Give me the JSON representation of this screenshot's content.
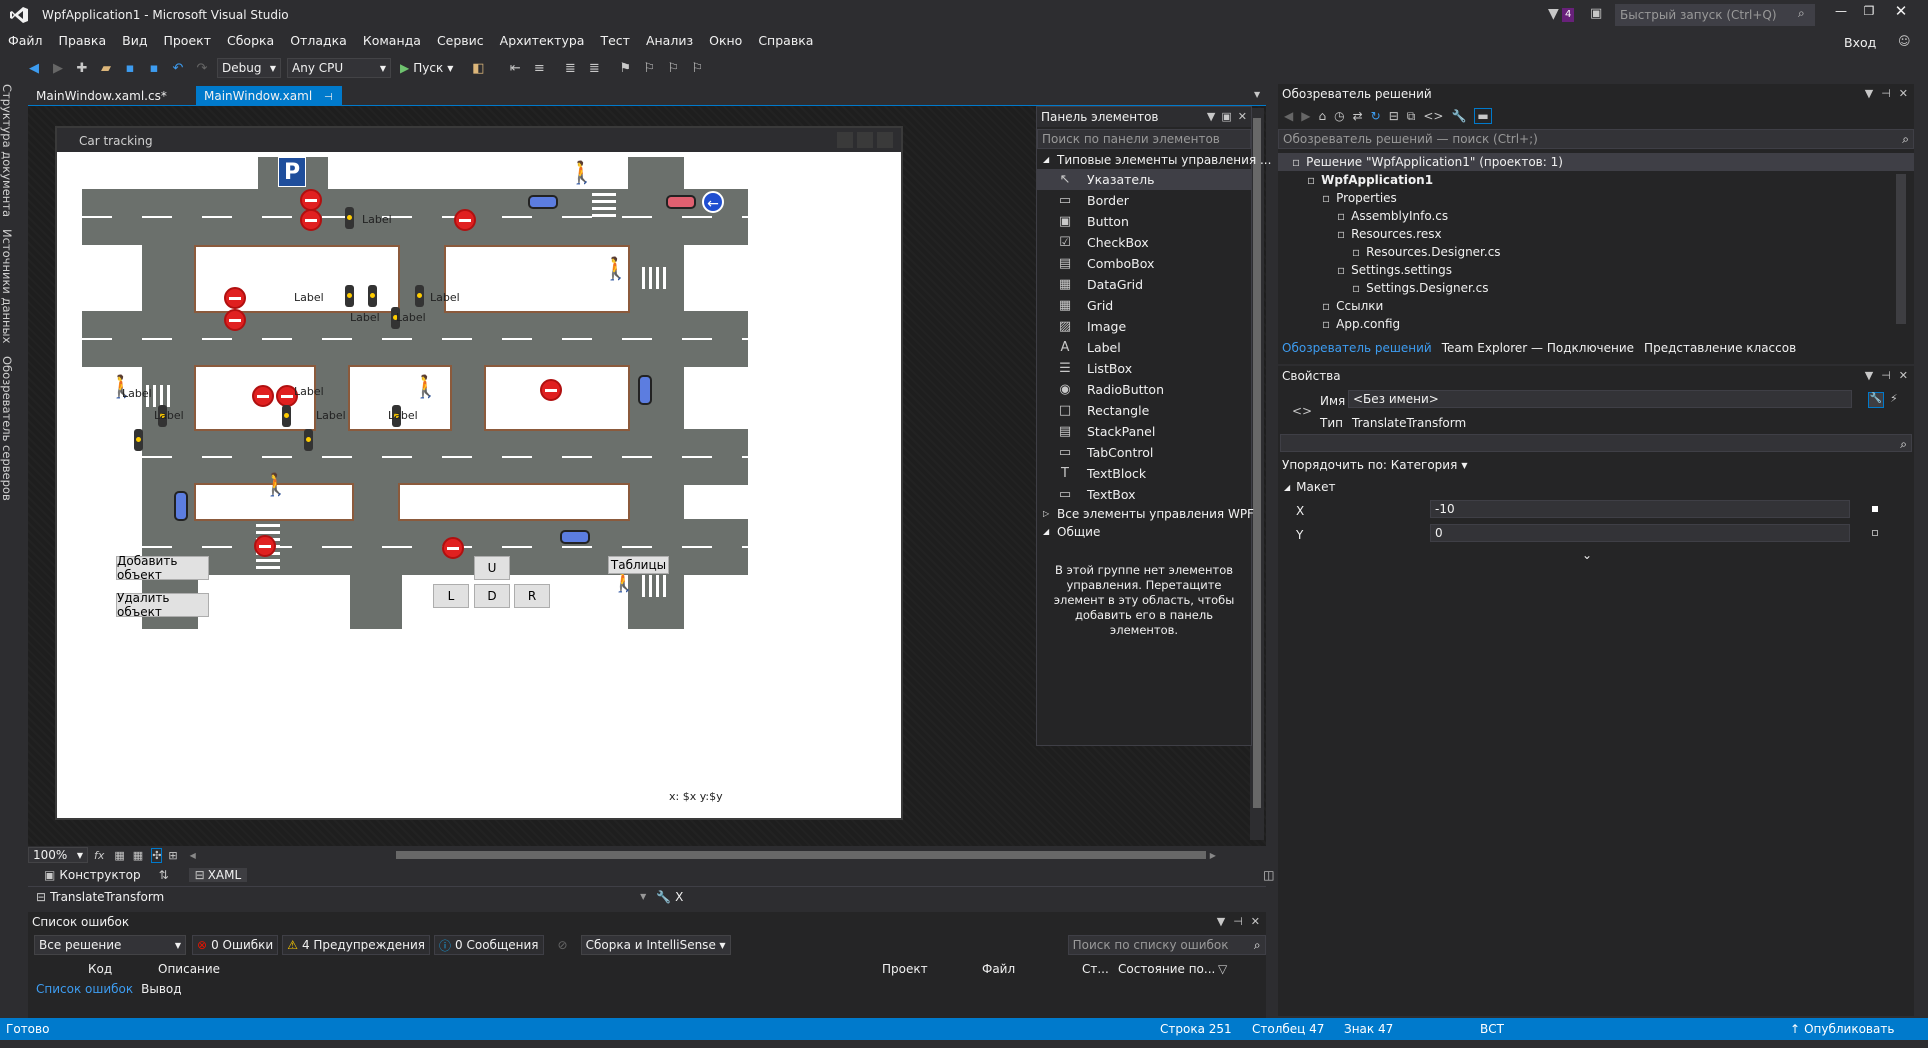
{
  "window": {
    "title": "WpfApplication1 - Microsoft Visual Studio",
    "notif_count": "4",
    "quick_launch": "Быстрый запуск (Ctrl+Q)",
    "signin": "Вход"
  },
  "menu": [
    "Файл",
    "Правка",
    "Вид",
    "Проект",
    "Сборка",
    "Отладка",
    "Команда",
    "Сервис",
    "Архитектура",
    "Тест",
    "Анализ",
    "Окно",
    "Справка"
  ],
  "toolbar": {
    "config": "Debug",
    "platform": "Any CPU",
    "run": "Пуск"
  },
  "left_tabs": [
    "Структура документа",
    "Источники данных",
    "Обозреватель серверов"
  ],
  "doc_tabs": [
    {
      "label": "MainWindow.xaml.cs*"
    },
    {
      "label": "MainWindow.xaml"
    }
  ],
  "wpf": {
    "title": "Car tracking",
    "parking": "P",
    "labels": [
      "Label",
      "Label",
      "Label",
      "Label",
      "Label",
      "Label",
      "Label",
      "Label",
      "Label",
      "Label"
    ],
    "btn_add": "Добавить объект",
    "btn_remove": "Удалить объект",
    "btn_u": "U",
    "btn_l": "L",
    "btn_d": "D",
    "btn_r": "R",
    "btn_tables": "Таблицы",
    "coords": "x: $x y:$y"
  },
  "designer_bottom": {
    "zoom": "100%",
    "fx": "fx",
    "tab_designer": "Конструктор",
    "tab_xaml": "XAML",
    "element_path": "TranslateTransform",
    "member": "X"
  },
  "toolbox": {
    "title": "Панель элементов",
    "search": "Поиск по панели элементов",
    "group_common": "Типовые элементы управления ...",
    "items": [
      {
        "label": "Указатель",
        "icon": "↖"
      },
      {
        "label": "Border",
        "icon": "▭"
      },
      {
        "label": "Button",
        "icon": "▣"
      },
      {
        "label": "CheckBox",
        "icon": "☑"
      },
      {
        "label": "ComboBox",
        "icon": "▤"
      },
      {
        "label": "DataGrid",
        "icon": "▦"
      },
      {
        "label": "Grid",
        "icon": "▦"
      },
      {
        "label": "Image",
        "icon": "▨"
      },
      {
        "label": "Label",
        "icon": "A"
      },
      {
        "label": "ListBox",
        "icon": "☰"
      },
      {
        "label": "RadioButton",
        "icon": "◉"
      },
      {
        "label": "Rectangle",
        "icon": "□"
      },
      {
        "label": "StackPanel",
        "icon": "▤"
      },
      {
        "label": "TabControl",
        "icon": "▭"
      },
      {
        "label": "TextBlock",
        "icon": "T"
      },
      {
        "label": "TextBox",
        "icon": "▭"
      }
    ],
    "group_all": "Все элементы управления WPF",
    "group_general": "Общие",
    "empty_text": "В этой группе нет элементов управления. Перетащите элемент в эту область, чтобы добавить его в панель элементов."
  },
  "solution": {
    "title": "Обозреватель решений",
    "search": "Обозреватель решений — поиск (Ctrl+;)",
    "tree": [
      {
        "label": "Решение \"WpfApplication1\" (проектов: 1)",
        "indent": 0,
        "bold": false
      },
      {
        "label": "WpfApplication1",
        "indent": 1,
        "bold": true
      },
      {
        "label": "Properties",
        "indent": 2,
        "bold": false
      },
      {
        "label": "AssemblyInfo.cs",
        "indent": 3,
        "bold": false
      },
      {
        "label": "Resources.resx",
        "indent": 3,
        "bold": false
      },
      {
        "label": "Resources.Designer.cs",
        "indent": 4,
        "bold": false
      },
      {
        "label": "Settings.settings",
        "indent": 3,
        "bold": false
      },
      {
        "label": "Settings.Designer.cs",
        "indent": 4,
        "bold": false
      },
      {
        "label": "Ссылки",
        "indent": 2,
        "bold": false
      },
      {
        "label": "App.config",
        "indent": 2,
        "bold": false
      }
    ],
    "tabs": [
      "Обозреватель решений",
      "Team Explorer — Подключение",
      "Представление классов"
    ]
  },
  "properties": {
    "title": "Свойства",
    "name_label": "Имя",
    "name_value": "<Без имени>",
    "type_label": "Тип",
    "type_value": "TranslateTransform",
    "sort": "Упорядочить по: Категория",
    "category": "Макет",
    "x_label": "X",
    "x_value": "-10",
    "y_label": "Y",
    "y_value": "0"
  },
  "errors": {
    "title": "Список ошибок",
    "scope": "Все решение",
    "errors": "0 Ошибки",
    "warnings": "4 Предупреждения",
    "messages": "0 Сообщения",
    "build": "Сборка и IntelliSense",
    "search": "Поиск по списку ошибок",
    "cols": [
      "Код",
      "Описание",
      "Проект",
      "Файл",
      "Ст...",
      "Состояние по..."
    ],
    "tabs": [
      "Список ошибок",
      "Вывод"
    ]
  },
  "status": {
    "ready": "Готово",
    "line": "Строка 251",
    "col": "Столбец 47",
    "char": "Знак 47",
    "ins": "ВСТ",
    "publish": "Опубликовать"
  },
  "colors": {
    "accent": "#007acc",
    "bg": "#2d2d30",
    "road": "#6b706c",
    "curb": "#8b5a3c"
  }
}
